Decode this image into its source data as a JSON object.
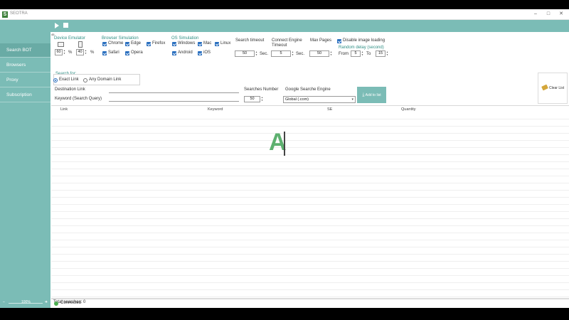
{
  "window": {
    "app_logo": "S",
    "title": "SEOTRA",
    "minimize": "–",
    "maximize": "□",
    "close": "✕"
  },
  "sidebar": {
    "items": [
      {
        "label": "Search BOT"
      },
      {
        "label": "Browsers"
      },
      {
        "label": "Proxy"
      },
      {
        "label": "Subscription"
      }
    ],
    "zoom": {
      "minus": "–",
      "value": "100%",
      "plus": "+"
    }
  },
  "settings": {
    "corner_marker": "45",
    "device_emulator": {
      "title": "Device Emulator",
      "desktop_value": "60",
      "mobile_value": "40",
      "unit": "%"
    },
    "browser_simulation": {
      "title": "Browser Simulation",
      "options": [
        "Chrome",
        "Edge",
        "Firefox",
        "Safari",
        "Opera"
      ]
    },
    "os_simulation": {
      "title": "OS Simulation",
      "options": [
        "Windows",
        "Mac",
        "Linux",
        "Android",
        "iOS"
      ]
    },
    "search_timeout": {
      "label": "Search timeout",
      "value": "50",
      "unit": "Sec."
    },
    "connect_engine_timeout": {
      "label": "Connect Engine Timeout",
      "value": "5",
      "unit": "Sec."
    },
    "max_pages": {
      "label": "Max Pages",
      "value": "50"
    },
    "disable_image_loading": {
      "label": "Disable image loading",
      "checked": true
    },
    "random_delay": {
      "label": "Random delay (second)",
      "from_label": "From",
      "from_value": "5",
      "to_label": "To",
      "to_value": "15"
    }
  },
  "search_form": {
    "search_for_label": "Search for:",
    "exact_link": "Exact Link",
    "any_domain_link": "Any Domain Link",
    "selected_mode": "Exact Link",
    "destination_link_label": "Destination Link",
    "destination_link_value": "",
    "keyword_label": "Keyword (Search Query)",
    "keyword_value": "",
    "searches_number_label": "Searches Number",
    "searches_number_value": "50",
    "engine_label": "Google Searche Engine",
    "engine_value": "Global (.com)",
    "add_button": "Add to list",
    "clear_button": "Clear List"
  },
  "table": {
    "columns": [
      "Link",
      "Keyword",
      "SE",
      "Quantity"
    ],
    "rows": [],
    "overlay_letter": "A"
  },
  "footer": {
    "total_searches_label": "Total searches:",
    "total_searches_value": "0",
    "status": "Connected",
    "status_color": "#4caf50"
  },
  "colors": {
    "accent": "#7bbcb6",
    "checkbox": "#2a6fbf",
    "group_title": "#2f8f85"
  },
  "icons": {
    "play": "play-icon",
    "stop": "stop-icon",
    "desktop": "desktop-icon",
    "mobile": "mobile-icon",
    "add": "download-icon",
    "clear": "eraser-icon"
  }
}
